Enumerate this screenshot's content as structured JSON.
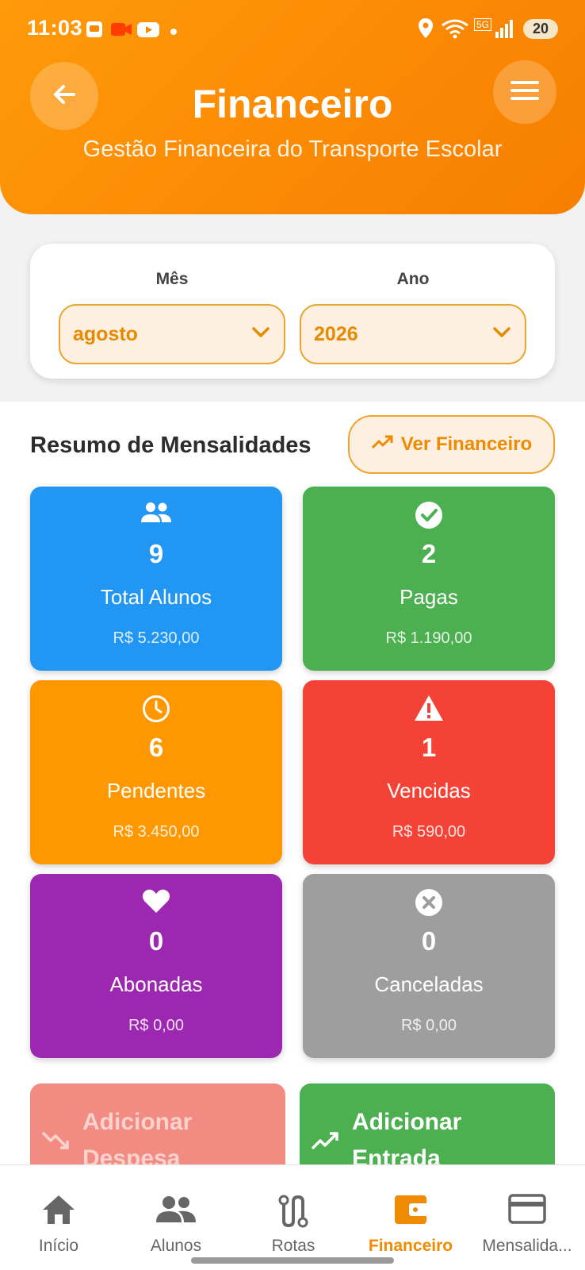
{
  "status_bar": {
    "time": "11:03",
    "network": "5G",
    "battery": "20"
  },
  "header": {
    "title": "Financeiro",
    "subtitle": "Gestão Financeira do Transporte Escolar",
    "back_icon": "arrow-left-icon",
    "menu_icon": "hamburger-menu-icon",
    "gradient_colors": [
      "#ff9a0a",
      "#f77f00"
    ]
  },
  "filters": {
    "month_label": "Mês",
    "month_value": "agosto",
    "year_label": "Ano",
    "year_value": "2026"
  },
  "summary": {
    "title": "Resumo de Mensalidades",
    "button_label": "Ver Financeiro",
    "cards": [
      {
        "icon": "people-icon",
        "count": "9",
        "label": "Total Alunos",
        "amount": "R$ 5.230,00",
        "color": "#2196f3"
      },
      {
        "icon": "check-circle-icon",
        "count": "2",
        "label": "Pagas",
        "amount": "R$ 1.190,00",
        "color": "#4caf50"
      },
      {
        "icon": "clock-icon",
        "count": "6",
        "label": "Pendentes",
        "amount": "R$ 3.450,00",
        "color": "#ff9800"
      },
      {
        "icon": "warning-icon",
        "count": "1",
        "label": "Vencidas",
        "amount": "R$ 590,00",
        "color": "#f44336"
      },
      {
        "icon": "heart-icon",
        "count": "0",
        "label": "Abonadas",
        "amount": "R$ 0,00",
        "color": "#9c27b0"
      },
      {
        "icon": "cancel-circle-icon",
        "count": "0",
        "label": "Canceladas",
        "amount": "R$ 0,00",
        "color": "#9e9e9e"
      }
    ]
  },
  "actions": {
    "expense_label": "Adicionar Despesa",
    "income_label": "Adicionar Entrada",
    "expense_color": "#f28b82",
    "income_color": "#4caf50"
  },
  "nav": {
    "items": [
      {
        "label": "Início",
        "icon": "home-icon"
      },
      {
        "label": "Alunos",
        "icon": "people-icon"
      },
      {
        "label": "Rotas",
        "icon": "route-icon"
      },
      {
        "label": "Financeiro",
        "icon": "wallet-icon"
      },
      {
        "label": "Mensalida...",
        "icon": "card-icon"
      }
    ],
    "active_color": "#f08a00"
  }
}
